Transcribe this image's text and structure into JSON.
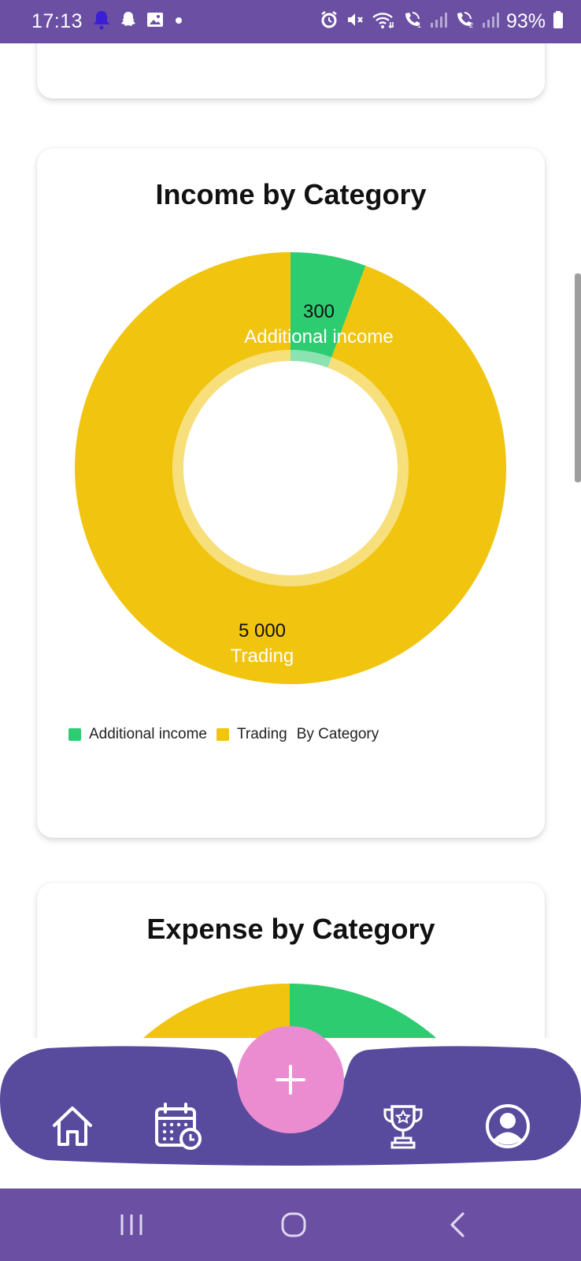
{
  "status_bar": {
    "time": "17:13",
    "battery": "93%",
    "left_icons": [
      "notification-bell-icon",
      "snapchat-icon",
      "gallery-icon",
      "dot-icon"
    ],
    "right_icons": [
      "alarm-icon",
      "mute-icon",
      "wifi-icon",
      "wifi-call-1-icon",
      "signal-1-icon",
      "wifi-call-2-icon",
      "signal-2-icon",
      "battery-icon"
    ]
  },
  "income_card": {
    "title": "Income by Category",
    "legend_title": "By Category"
  },
  "expense_card": {
    "title": "Expense by Category"
  },
  "chart_data": [
    {
      "type": "pie",
      "title": "Income by Category",
      "categories": [
        "Additional income",
        "Trading"
      ],
      "values": [
        300,
        5000
      ],
      "value_labels": [
        "300",
        "5 000"
      ],
      "colors": [
        "#2ecc71",
        "#f1c40f"
      ],
      "donut": true,
      "legend": "bottom-left",
      "legend_title": "By Category"
    },
    {
      "type": "pie",
      "title": "Expense by Category",
      "categories": [],
      "values": [],
      "colors": [
        "#2ecc71",
        "#f1c40f"
      ],
      "donut": true
    }
  ],
  "bottom_nav": {
    "items": [
      "home-icon",
      "calendar-icon",
      "trophy-icon",
      "profile-icon"
    ],
    "fab_icon": "plus-icon",
    "background": "#584a9c",
    "fab_color": "#ea8ccf"
  },
  "system_nav": {
    "items": [
      "recent-apps-icon",
      "home-circle-icon",
      "back-icon"
    ]
  },
  "colors": {
    "status_bar": "#6a4fa3",
    "green": "#2ecc71",
    "yellow": "#f1c40f"
  }
}
